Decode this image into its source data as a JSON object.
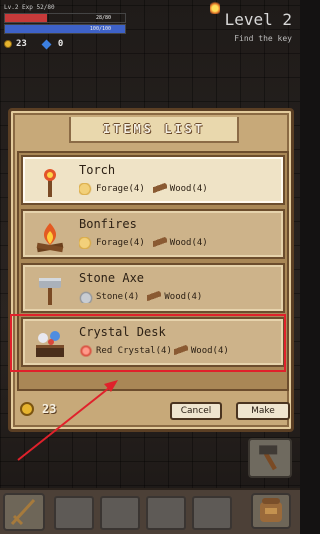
{
  "hud": {
    "level_exp": "Lv.2 Exp 52/80",
    "hp_text": "28/80",
    "hp_fraction": 0.35,
    "mp_text": "100/100",
    "mp_fraction": 1.0,
    "coins": "23",
    "gems": "0"
  },
  "level": {
    "title": "Level 2",
    "subtitle": "Find the key"
  },
  "panel": {
    "title": "ITEMS LIST",
    "items": [
      {
        "name": "Torch",
        "icon": "torch-icon",
        "reqs": [
          {
            "label": "Forage(4)",
            "icon": "forage-icon"
          },
          {
            "label": "Wood(4)",
            "icon": "wood-icon"
          }
        ]
      },
      {
        "name": "Bonfires",
        "icon": "bonfire-icon",
        "reqs": [
          {
            "label": "Forage(4)",
            "icon": "forage-icon"
          },
          {
            "label": "Wood(4)",
            "icon": "wood-icon"
          }
        ]
      },
      {
        "name": "Stone Axe",
        "icon": "stone-axe-icon",
        "reqs": [
          {
            "label": "Stone(4)",
            "icon": "stone-icon"
          },
          {
            "label": "Wood(4)",
            "icon": "wood-icon"
          }
        ]
      },
      {
        "name": "Crystal Desk",
        "icon": "crystal-desk-icon",
        "reqs": [
          {
            "label": "Red Crystal(4)",
            "icon": "red-crystal-icon"
          },
          {
            "label": "Wood(4)",
            "icon": "wood-icon"
          }
        ]
      }
    ],
    "coins": "23",
    "cancel_label": "Cancel",
    "make_label": "Make"
  },
  "colors": {
    "highlight": "#e0212b",
    "panel": "#c7a979",
    "hp": "#c63a3a",
    "mp": "#3e62c8"
  }
}
